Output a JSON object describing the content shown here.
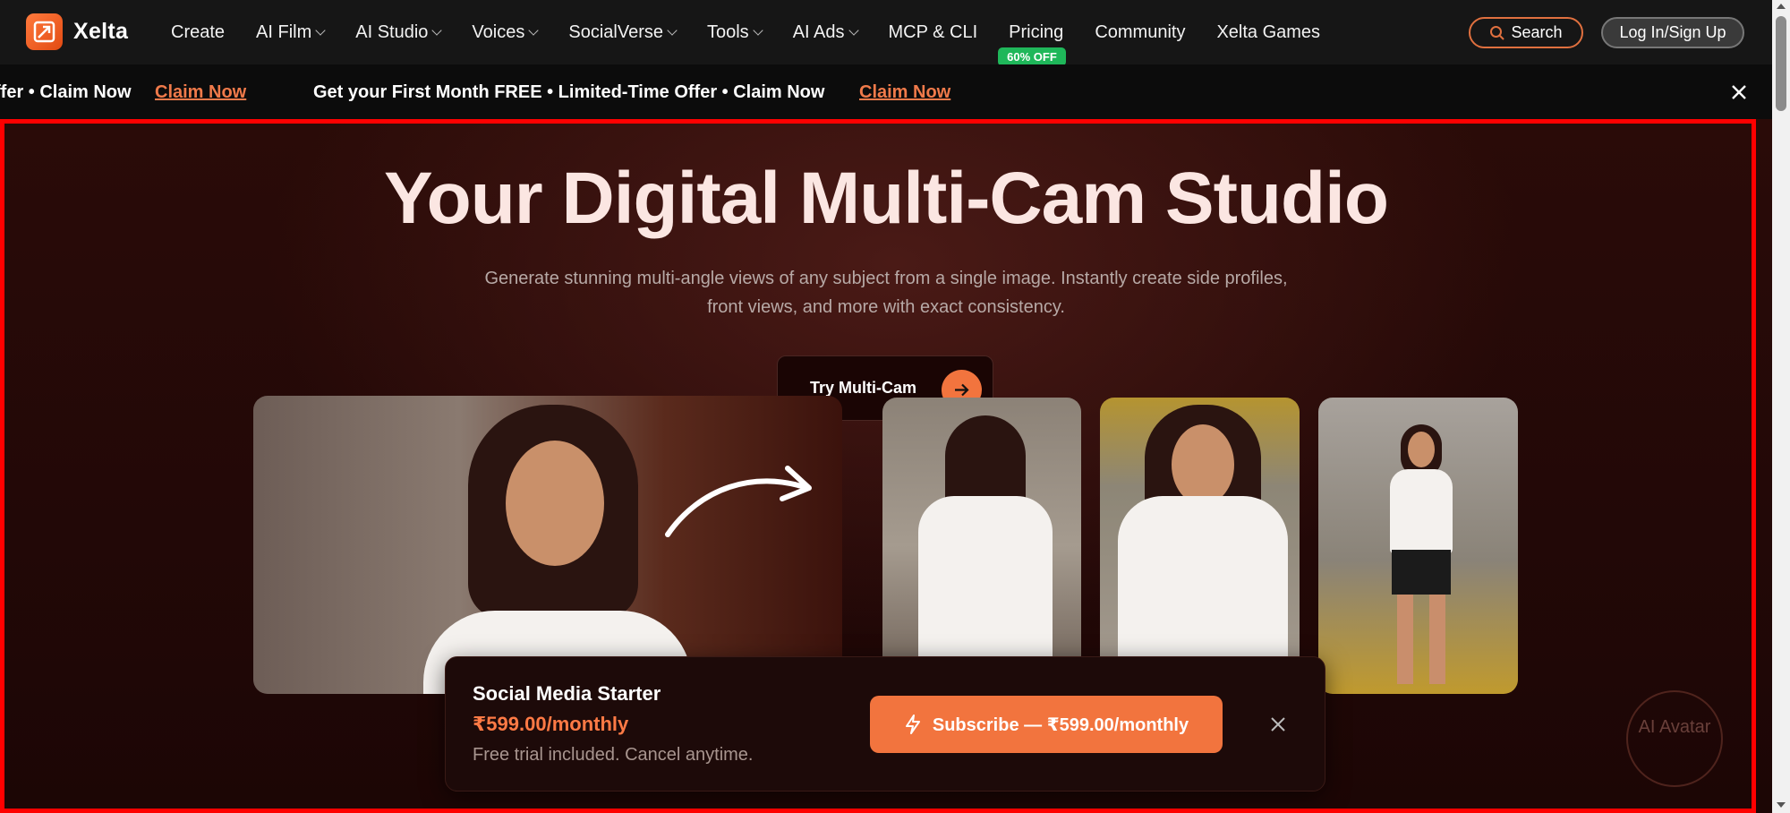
{
  "brand": {
    "name": "Xelta"
  },
  "nav": {
    "items": [
      {
        "label": "Create",
        "dropdown": false
      },
      {
        "label": "AI Film",
        "dropdown": true
      },
      {
        "label": "AI Studio",
        "dropdown": true
      },
      {
        "label": "Voices",
        "dropdown": true
      },
      {
        "label": "SocialVerse",
        "dropdown": true
      },
      {
        "label": "Tools",
        "dropdown": true
      },
      {
        "label": "AI Ads",
        "dropdown": true
      },
      {
        "label": "MCP & CLI",
        "dropdown": false
      },
      {
        "label": "Pricing",
        "dropdown": false,
        "badge": "60% OFF"
      },
      {
        "label": "Community",
        "dropdown": false
      },
      {
        "label": "Xelta Games",
        "dropdown": false
      }
    ],
    "search_label": "Search",
    "login_label": "Log In/Sign Up"
  },
  "promo": {
    "text_partial": "ffer • Claim Now",
    "text_full": "Get your First Month FREE • Limited-Time Offer • Claim Now",
    "claim_label": "Claim Now"
  },
  "hero": {
    "title": "Your Digital Multi-Cam Studio",
    "subtitle": "Generate stunning multi-angle views of any subject from a single image. Instantly create side profiles, front views, and more with exact consistency.",
    "cta_label": "Try Multi-Cam"
  },
  "subscription": {
    "plan": "Social Media Starter",
    "price": "₹599.00/monthly",
    "note": "Free trial included. Cancel anytime.",
    "button_label": "Subscribe — ₹599.00/monthly"
  },
  "avatar_widget": {
    "label": "AI Avatar"
  },
  "colors": {
    "accent": "#f2743e",
    "badge": "#1fb75a",
    "highlight": "#ff0000"
  }
}
